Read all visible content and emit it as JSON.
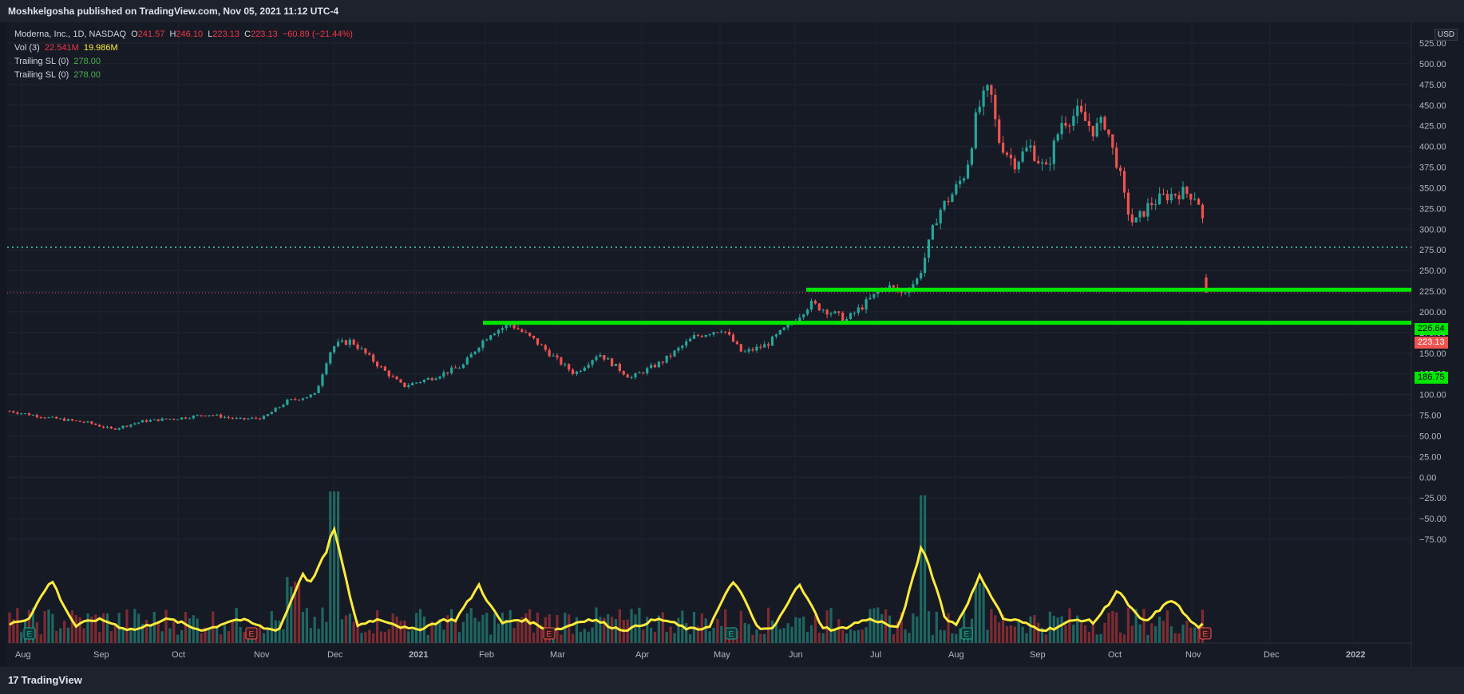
{
  "header": {
    "published_by": "Moshkelgosha published on TradingView.com, Nov 05, 2021 11:12 UTC-4"
  },
  "legend": {
    "symbol": "Moderna, Inc., 1D, NASDAQ",
    "open_label": "O",
    "open": "241.57",
    "high_label": "H",
    "high": "246.10",
    "low_label": "L",
    "low": "223.13",
    "close_label": "C",
    "close": "223.13",
    "change": "−60.89 (−21.44%)",
    "vol_label": "Vol (3)",
    "vol": "22.541M",
    "vol_ma": "19.986M",
    "trailing1_label": "Trailing SL (0)",
    "trailing1": "278.00",
    "trailing2_label": "Trailing SL (0)",
    "trailing2": "278.00"
  },
  "axis": {
    "currency": "USD",
    "y_ticks": [
      "525.00",
      "500.00",
      "475.00",
      "450.00",
      "425.00",
      "400.00",
      "375.00",
      "350.00",
      "325.00",
      "300.00",
      "275.00",
      "250.00",
      "225.00",
      "200.00",
      "175.00",
      "150.00",
      "125.00",
      "100.00",
      "75.00",
      "50.00",
      "25.00",
      "0.00",
      "−25.00",
      "−50.00",
      "−75.00"
    ],
    "x_ticks": [
      "Aug",
      "Sep",
      "Oct",
      "Nov",
      "Dec",
      "2021",
      "Feb",
      "Mar",
      "Apr",
      "May",
      "Jun",
      "Jul",
      "Aug",
      "Sep",
      "Oct",
      "Nov",
      "Dec",
      "2022"
    ]
  },
  "price_labels": {
    "level_upper": "226.64",
    "last_price": "223.13",
    "level_lower": "186.75"
  },
  "footer": {
    "brand": "TradingView"
  },
  "colors": {
    "up": "#26a69a",
    "down": "#ef5350",
    "level": "#00e600",
    "vol_ma": "#ffeb3b",
    "trailing": "#4dd0b0"
  },
  "chart_data": {
    "type": "candlestick",
    "title": "Moderna, Inc., 1D, NASDAQ",
    "y_range": [
      -85,
      550
    ],
    "levels": [
      226.64,
      186.75
    ],
    "trailing_stop": 278.0,
    "last_price": 223.13,
    "series": [
      {
        "date": "2020-08",
        "close": 72
      },
      {
        "date": "2020-09",
        "close": 70
      },
      {
        "date": "2020-10",
        "close": 72
      },
      {
        "date": "2020-11",
        "close": 95
      },
      {
        "date": "2020-12",
        "close": 160
      },
      {
        "date": "2021-01",
        "close": 115
      },
      {
        "date": "2021-02",
        "close": 180
      },
      {
        "date": "2021-03",
        "close": 130
      },
      {
        "date": "2021-04",
        "close": 130
      },
      {
        "date": "2021-05",
        "close": 155
      },
      {
        "date": "2021-06",
        "close": 210
      },
      {
        "date": "2021-07",
        "close": 240
      },
      {
        "date": "2021-08",
        "close": 390
      },
      {
        "date": "2021-09",
        "close": 425
      },
      {
        "date": "2021-10",
        "close": 320
      },
      {
        "date": "2021-11",
        "close": 223.13
      }
    ]
  }
}
